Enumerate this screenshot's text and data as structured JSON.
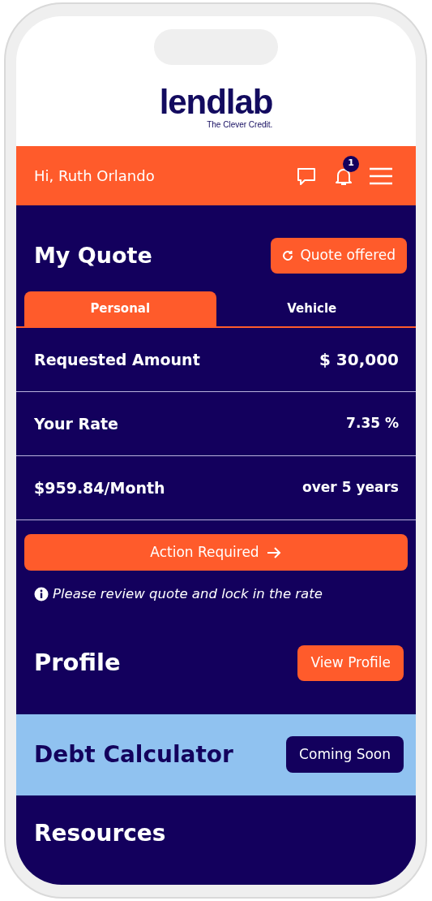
{
  "brand": {
    "logo": "lendlab",
    "tagline": "The Clever Credit."
  },
  "header": {
    "greeting": "Hi, Ruth Orlando",
    "notification_count": "1"
  },
  "quote": {
    "title": "My Quote",
    "status_button": "Quote offered",
    "tabs": [
      {
        "label": "Personal",
        "selected": true
      },
      {
        "label": "Vehicle",
        "selected": false
      }
    ],
    "rows": [
      {
        "label": "Requested Amount",
        "value": "$ 30,000",
        "kind": "large"
      },
      {
        "label": "Your Rate",
        "value": "7.35 %",
        "kind": "small"
      },
      {
        "label": "$959.84/Month",
        "value": "over 5 years",
        "kind": "small"
      }
    ],
    "action_button": "Action Required",
    "note": "Please review quote and lock in the rate"
  },
  "profile": {
    "title": "Profile",
    "button": "View Profile"
  },
  "debt_calculator": {
    "title": "Debt Calculator",
    "badge": "Coming Soon"
  },
  "resources": {
    "title": "Resources"
  }
}
